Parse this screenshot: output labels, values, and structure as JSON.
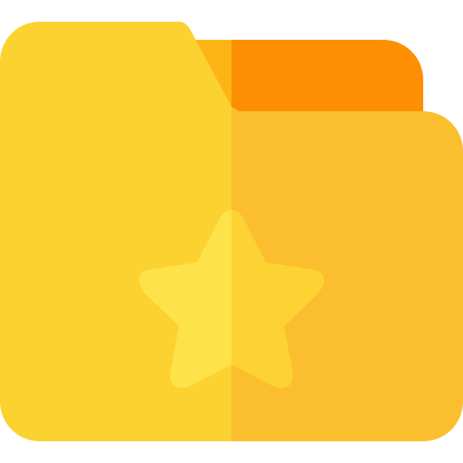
{
  "icon": {
    "name": "starred-folder-icon",
    "colors": {
      "folder_front_left": "#FCD230",
      "folder_front_right": "#FBBE2E",
      "folder_back_left": "#FDB515",
      "folder_back_right": "#FD8F02",
      "star_left": "#FEE24A",
      "star_right": "#FDD333"
    }
  }
}
